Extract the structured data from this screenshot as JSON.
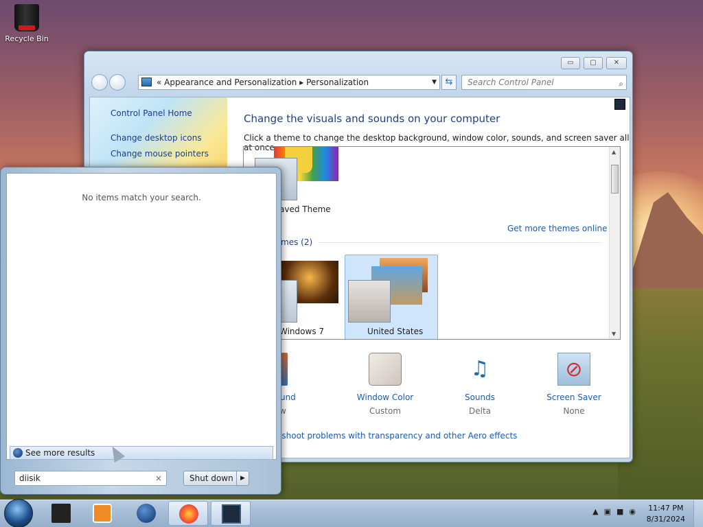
{
  "desktop": {
    "recycle_bin_label": "Recycle Bin"
  },
  "window": {
    "address": {
      "prefix": "«",
      "crumb1": "Appearance and Personalization",
      "separator": "▸",
      "crumb2": "Personalization"
    },
    "search_placeholder": "Search Control Panel",
    "left_pane": [
      "Control Panel Home",
      "Change desktop icons",
      "Change mouse pointers"
    ],
    "heading": "Change the visuals and sounds on your computer",
    "subheading": "Click a theme to change the desktop background, window color, sounds, and screen saver all at once.",
    "themes": {
      "my_theme_label": "aved Theme",
      "get_more_link": "Get more themes online",
      "section_title": "mes (2)",
      "items": [
        {
          "label": "Windows 7",
          "visible_label": "Windows 7"
        },
        {
          "label": "United States",
          "selected": true
        }
      ]
    },
    "bottom": [
      {
        "title": "Background",
        "subtitle": "e Show"
      },
      {
        "title": "Window Color",
        "subtitle": "Custom"
      },
      {
        "title": "Sounds",
        "subtitle": "Delta"
      },
      {
        "title": "Screen Saver",
        "subtitle": "None"
      }
    ],
    "troubleshoot_link": "eshoot problems with transparency and other Aero effects"
  },
  "start_menu": {
    "no_items": "No items match your search.",
    "see_more": "See more results",
    "search_value": "diisik",
    "shutdown_label": "Shut down"
  },
  "taskbar": {
    "clock_time": "11:47 PM",
    "clock_date": "8/31/2024"
  },
  "colors": {
    "link": "#1a5bb5",
    "heading": "#1e3f8e",
    "selection": "#cfe5fb"
  }
}
